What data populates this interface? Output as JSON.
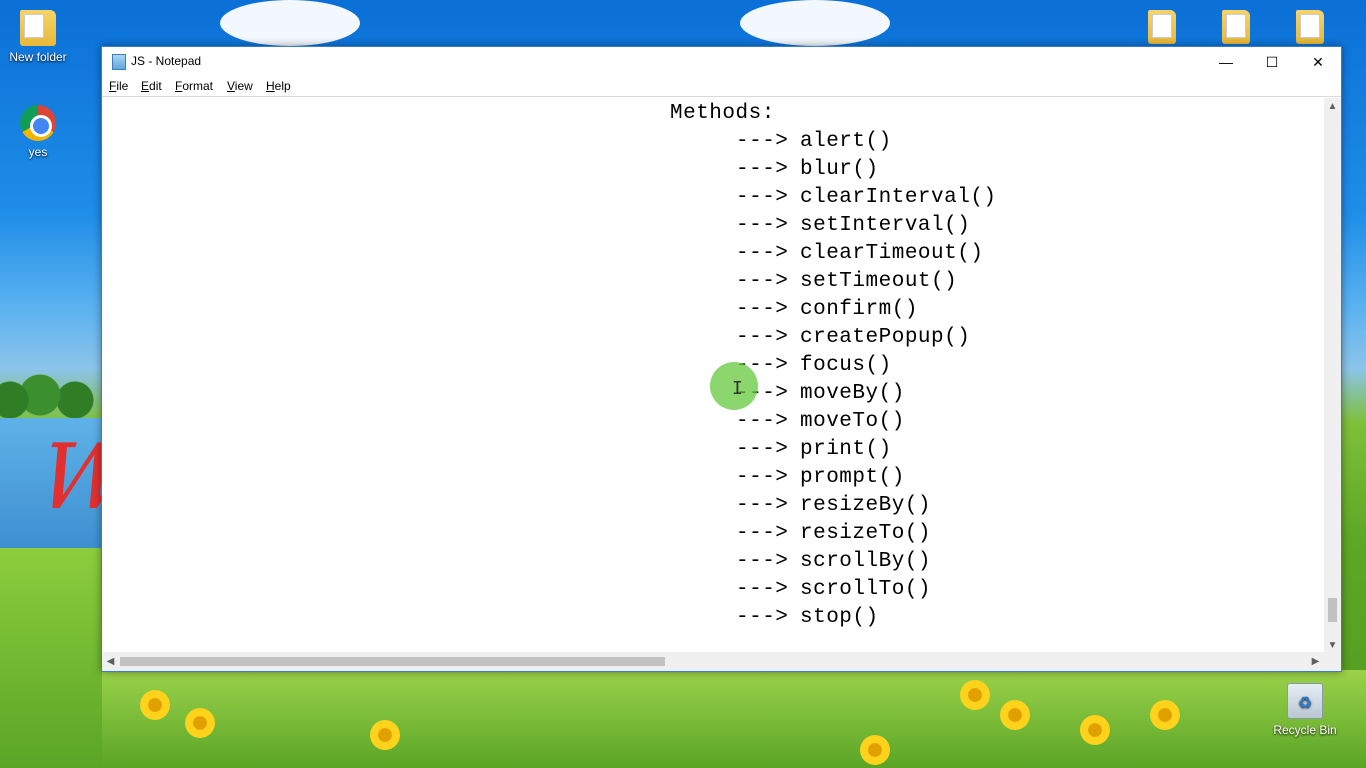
{
  "desktop": {
    "icons": [
      {
        "label": "New folder",
        "icon": "folder-icon"
      },
      {
        "label": "yes",
        "icon": "chrome-icon"
      },
      {
        "label": "Recycle Bin",
        "icon": "recycle-bin-icon"
      }
    ]
  },
  "window": {
    "title": "JS - Notepad",
    "controls": {
      "minimize": "—",
      "maximize": "☐",
      "close": "✕"
    },
    "menu": [
      {
        "mnemonic": "F",
        "rest": "ile"
      },
      {
        "mnemonic": "E",
        "rest": "dit"
      },
      {
        "mnemonic": "F",
        "rest": "ormat"
      },
      {
        "mnemonic": "V",
        "rest": "iew"
      },
      {
        "mnemonic": "H",
        "rest": "elp"
      }
    ]
  },
  "editor": {
    "heading": "Methods:",
    "arrow": "--->",
    "methods": [
      "alert()",
      "blur()",
      "clearInterval()",
      "setInterval()",
      "clearTimeout()",
      "setTimeout()",
      "confirm()",
      "createPopup()",
      "focus()",
      "moveBy()",
      "moveTo()",
      "print()",
      "prompt()",
      "resizeBy()",
      "resizeTo()",
      "scrollBy()",
      "scrollTo()",
      "stop()"
    ]
  },
  "scrollbars": {
    "up": "▲",
    "down": "▼",
    "left": "◀",
    "right": "▶"
  },
  "colors": {
    "accent": "#3a7bd5",
    "cursor_highlight": "#64c83c"
  }
}
